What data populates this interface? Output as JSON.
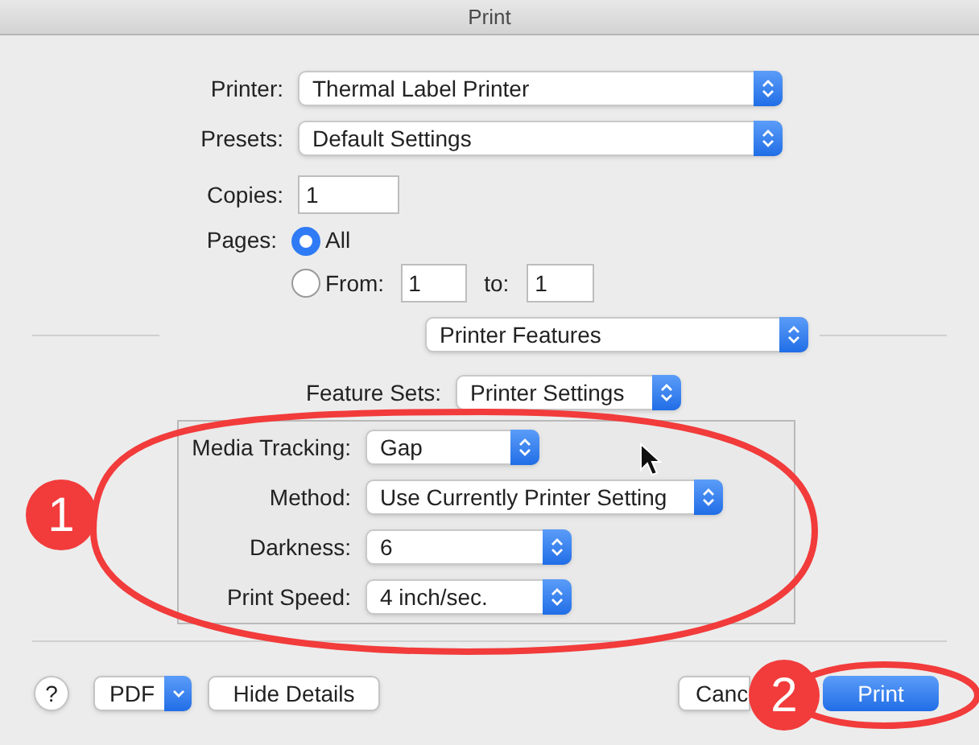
{
  "window": {
    "title": "Print"
  },
  "printer": {
    "label": "Printer:",
    "value": "Thermal Label Printer"
  },
  "presets": {
    "label": "Presets:",
    "value": "Default Settings"
  },
  "copies": {
    "label": "Copies:",
    "value": "1"
  },
  "pages": {
    "label": "Pages:",
    "options": [
      {
        "label": "All",
        "selected": true
      },
      {
        "label": "From:",
        "selected": false
      }
    ],
    "from": "1",
    "to_label": "to:",
    "to": "1"
  },
  "section": {
    "value": "Printer Features"
  },
  "feature_sets": {
    "label": "Feature Sets:",
    "value": "Printer Settings"
  },
  "settings": [
    {
      "label": "Media Tracking:",
      "value": "Gap"
    },
    {
      "label": "Method:",
      "value": "Use Currently Printer Setting"
    },
    {
      "label": "Darkness:",
      "value": "6"
    },
    {
      "label": "Print Speed:",
      "value": "4 inch/sec."
    }
  ],
  "buttons": {
    "help": "?",
    "pdf": "PDF",
    "details": "Hide Details",
    "cancel": "Canc",
    "print": "Print"
  },
  "annotations": [
    {
      "label": "1"
    },
    {
      "label": "2"
    }
  ]
}
